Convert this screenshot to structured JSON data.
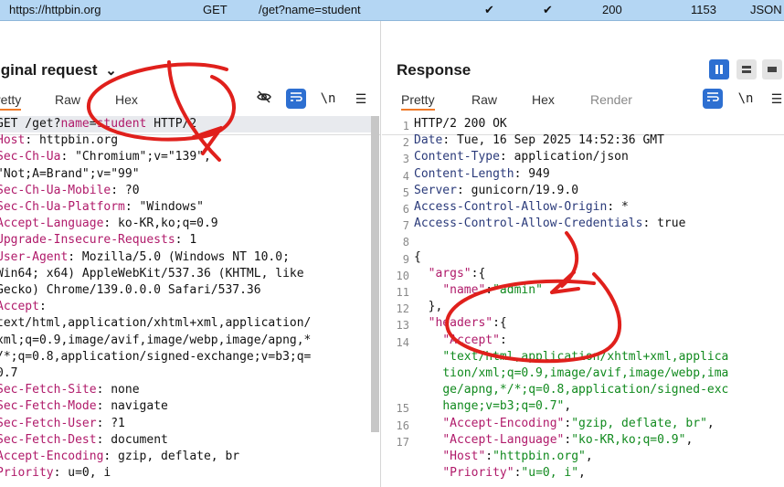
{
  "history_row": {
    "host": "https://httpbin.org",
    "method": "GET",
    "url": "/get?name=student",
    "check1": "✔",
    "check2": "✔",
    "status": "200",
    "length": "1153",
    "mime": "JSON"
  },
  "request": {
    "title": "iginal request",
    "chevron": "⌄",
    "tabs": [
      "retty",
      "Raw",
      "Hex"
    ],
    "icons": {
      "eye_off": "eye-off-icon",
      "wrap": "wrap-icon",
      "newline": "\\n",
      "menu": "☰"
    },
    "lines": [
      {
        "parts": [
          {
            "t": "GET /get?",
            "c": "v"
          },
          {
            "t": "name",
            "c": "k"
          },
          {
            "t": "=",
            "c": "v"
          },
          {
            "t": "student",
            "c": "k"
          },
          {
            "t": " HTTP/2",
            "c": "v"
          }
        ]
      },
      {
        "parts": [
          {
            "t": "Host",
            "c": "k"
          },
          {
            "t": ": httpbin.org",
            "c": "v"
          }
        ]
      },
      {
        "parts": [
          {
            "t": "Sec-Ch-Ua",
            "c": "k"
          },
          {
            "t": ": \"Chromium\";v=\"139\",",
            "c": "v"
          }
        ]
      },
      {
        "parts": [
          {
            "t": "\"Not;A=Brand\";v=\"99\"",
            "c": "v"
          }
        ]
      },
      {
        "parts": [
          {
            "t": "Sec-Ch-Ua-Mobile",
            "c": "k"
          },
          {
            "t": ": ?0",
            "c": "v"
          }
        ]
      },
      {
        "parts": [
          {
            "t": "Sec-Ch-Ua-Platform",
            "c": "k"
          },
          {
            "t": ": \"Windows\"",
            "c": "v"
          }
        ]
      },
      {
        "parts": [
          {
            "t": "Accept-Language",
            "c": "k"
          },
          {
            "t": ": ko-KR,ko;q=0.9",
            "c": "v"
          }
        ]
      },
      {
        "parts": [
          {
            "t": "Upgrade-Insecure-Requests",
            "c": "k"
          },
          {
            "t": ": 1",
            "c": "v"
          }
        ]
      },
      {
        "parts": [
          {
            "t": "User-Agent",
            "c": "k"
          },
          {
            "t": ": Mozilla/5.0 (Windows NT 10.0;",
            "c": "v"
          }
        ]
      },
      {
        "parts": [
          {
            "t": "Win64; x64) AppleWebKit/537.36 (KHTML, like",
            "c": "v"
          }
        ]
      },
      {
        "parts": [
          {
            "t": "Gecko) Chrome/139.0.0.0 Safari/537.36",
            "c": "v"
          }
        ]
      },
      {
        "parts": [
          {
            "t": "Accept",
            "c": "k"
          },
          {
            "t": ":",
            "c": "v"
          }
        ]
      },
      {
        "parts": [
          {
            "t": "text/html,application/xhtml+xml,application/",
            "c": "v"
          }
        ]
      },
      {
        "parts": [
          {
            "t": "xml;q=0.9,image/avif,image/webp,image/apng,*",
            "c": "v"
          }
        ]
      },
      {
        "parts": [
          {
            "t": "/*;q=0.8,application/signed-exchange;v=b3;q=",
            "c": "v"
          }
        ]
      },
      {
        "parts": [
          {
            "t": "0.7",
            "c": "v"
          }
        ]
      },
      {
        "parts": [
          {
            "t": "Sec-Fetch-Site",
            "c": "k"
          },
          {
            "t": ": none",
            "c": "v"
          }
        ]
      },
      {
        "parts": [
          {
            "t": "Sec-Fetch-Mode",
            "c": "k"
          },
          {
            "t": ": navigate",
            "c": "v"
          }
        ]
      },
      {
        "parts": [
          {
            "t": "Sec-Fetch-User",
            "c": "k"
          },
          {
            "t": ": ?1",
            "c": "v"
          }
        ]
      },
      {
        "parts": [
          {
            "t": "Sec-Fetch-Dest",
            "c": "k"
          },
          {
            "t": ": document",
            "c": "v"
          }
        ]
      },
      {
        "parts": [
          {
            "t": "Accept-Encoding",
            "c": "k"
          },
          {
            "t": ": gzip, deflate, br",
            "c": "v"
          }
        ]
      },
      {
        "parts": [
          {
            "t": "Priority",
            "c": "k"
          },
          {
            "t": ": u=0, i",
            "c": "v"
          }
        ]
      }
    ]
  },
  "response": {
    "title": "Response",
    "tabs": [
      "Pretty",
      "Raw",
      "Hex",
      "Render"
    ],
    "icons": {
      "wrap": "wrap-icon",
      "newline": "\\n",
      "menu": "☰"
    },
    "line_numbers": [
      "1",
      "2",
      "3",
      "4",
      "5",
      "6",
      "7",
      "8",
      "9",
      "10",
      "11",
      "12",
      "13",
      "14",
      "",
      "",
      "",
      "15",
      "16",
      "17"
    ],
    "lines": [
      {
        "parts": [
          {
            "t": "HTTP/2 200 OK",
            "c": "v"
          }
        ]
      },
      {
        "parts": [
          {
            "t": "Date",
            "c": "n"
          },
          {
            "t": ": Tue, 16 Sep 2025 14:52:36 GMT",
            "c": "v"
          }
        ]
      },
      {
        "parts": [
          {
            "t": "Content-Type",
            "c": "n"
          },
          {
            "t": ": application/json",
            "c": "v"
          }
        ]
      },
      {
        "parts": [
          {
            "t": "Content-Length",
            "c": "n"
          },
          {
            "t": ": 949",
            "c": "v"
          }
        ]
      },
      {
        "parts": [
          {
            "t": "Server",
            "c": "n"
          },
          {
            "t": ": gunicorn/19.9.0",
            "c": "v"
          }
        ]
      },
      {
        "parts": [
          {
            "t": "Access-Control-Allow-Origin",
            "c": "n"
          },
          {
            "t": ": *",
            "c": "v"
          }
        ]
      },
      {
        "parts": [
          {
            "t": "Access-Control-Allow-Credentials",
            "c": "n"
          },
          {
            "t": ": true",
            "c": "v"
          }
        ]
      },
      {
        "parts": [
          {
            "t": "",
            "c": "v"
          }
        ]
      },
      {
        "parts": [
          {
            "t": "{",
            "c": "v"
          }
        ]
      },
      {
        "parts": [
          {
            "t": "  ",
            "c": "v"
          },
          {
            "t": "\"args\"",
            "c": "k"
          },
          {
            "t": ":{",
            "c": "v"
          }
        ]
      },
      {
        "parts": [
          {
            "t": "    ",
            "c": "v"
          },
          {
            "t": "\"name\"",
            "c": "k"
          },
          {
            "t": ":",
            "c": "v"
          },
          {
            "t": "\"admin\"",
            "c": "s"
          }
        ]
      },
      {
        "parts": [
          {
            "t": "  },",
            "c": "v"
          }
        ]
      },
      {
        "parts": [
          {
            "t": "  ",
            "c": "v"
          },
          {
            "t": "\"headers\"",
            "c": "k"
          },
          {
            "t": ":{",
            "c": "v"
          }
        ]
      },
      {
        "parts": [
          {
            "t": "    ",
            "c": "v"
          },
          {
            "t": "\"Accept\"",
            "c": "k"
          },
          {
            "t": ":",
            "c": "v"
          }
        ]
      },
      {
        "parts": [
          {
            "t": "    ",
            "c": "v"
          },
          {
            "t": "\"text/html,application/xhtml+xml,applica",
            "c": "s"
          }
        ]
      },
      {
        "parts": [
          {
            "t": "    ",
            "c": "v"
          },
          {
            "t": "tion/xml;q=0.9,image/avif,image/webp,ima",
            "c": "s"
          }
        ]
      },
      {
        "parts": [
          {
            "t": "    ",
            "c": "v"
          },
          {
            "t": "ge/apng,*/*;q=0.8,application/signed-exc",
            "c": "s"
          }
        ]
      },
      {
        "parts": [
          {
            "t": "    ",
            "c": "v"
          },
          {
            "t": "hange;v=b3;q=0.7\"",
            "c": "s"
          },
          {
            "t": ",",
            "c": "v"
          }
        ]
      },
      {
        "parts": [
          {
            "t": "    ",
            "c": "v"
          },
          {
            "t": "\"Accept-Encoding\"",
            "c": "k"
          },
          {
            "t": ":",
            "c": "v"
          },
          {
            "t": "\"gzip, deflate, br\"",
            "c": "s"
          },
          {
            "t": ",",
            "c": "v"
          }
        ]
      },
      {
        "parts": [
          {
            "t": "    ",
            "c": "v"
          },
          {
            "t": "\"Accept-Language\"",
            "c": "k"
          },
          {
            "t": ":",
            "c": "v"
          },
          {
            "t": "\"ko-KR,ko;q=0.9\"",
            "c": "s"
          },
          {
            "t": ",",
            "c": "v"
          }
        ]
      },
      {
        "parts": [
          {
            "t": "    ",
            "c": "v"
          },
          {
            "t": "\"Host\"",
            "c": "k"
          },
          {
            "t": ":",
            "c": "v"
          },
          {
            "t": "\"httpbin.org\"",
            "c": "s"
          },
          {
            "t": ",",
            "c": "v"
          }
        ]
      },
      {
        "parts": [
          {
            "t": "    ",
            "c": "v"
          },
          {
            "t": "\"Priority\"",
            "c": "k"
          },
          {
            "t": ":",
            "c": "v"
          },
          {
            "t": "\"u=0, i\"",
            "c": "s"
          },
          {
            "t": ",",
            "c": "v"
          }
        ]
      }
    ]
  },
  "colors": {
    "accent": "#2d6fd1",
    "tab_underline": "#f07a28",
    "key": "#b01a6a",
    "string": "#118a1e",
    "annotation": "#e0201c"
  }
}
